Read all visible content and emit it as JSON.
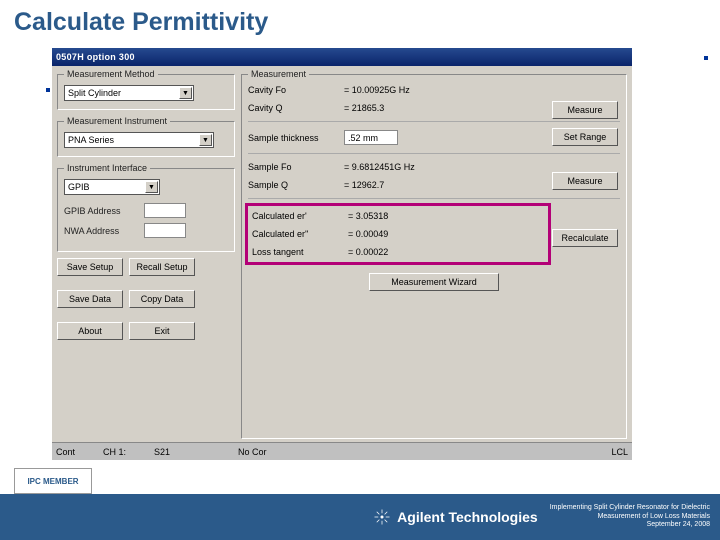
{
  "slide": {
    "title": "Calculate Permittivity"
  },
  "window": {
    "title": "0507H  option 300"
  },
  "method": {
    "legend": "Measurement Method",
    "value": "Split Cylinder"
  },
  "instrument": {
    "legend": "Measurement Instrument",
    "value": "PNA Series"
  },
  "iface": {
    "legend": "Instrument Interface",
    "value": "GPIB",
    "gpib_label": "GPIB Address",
    "nwa_label": "NWA Address"
  },
  "buttons": {
    "save_setup": "Save Setup",
    "recall_setup": "Recall Setup",
    "save_data": "Save Data",
    "copy_data": "Copy Data",
    "about": "About",
    "exit": "Exit",
    "measure": "Measure",
    "set_range": "Set Range",
    "recalc": "Recalculate",
    "wizard": "Measurement Wizard"
  },
  "meas": {
    "legend": "Measurement",
    "cavity_fo_label": "Cavity Fo",
    "cavity_fo_value": "= 10.00925G Hz",
    "cavity_q_label": "Cavity Q",
    "cavity_q_value": "= 21865.3",
    "sample_thickness_label": "Sample thickness",
    "sample_thickness_value": ".52 mm",
    "sample_fo_label": "Sample Fo",
    "sample_fo_value": "= 9.6812451G Hz",
    "sample_q_label": "Sample Q",
    "sample_q_value": "= 12962.7",
    "calc_er_prime_label": "Calculated er'",
    "calc_er_prime_value": "= 3.05318",
    "calc_er_dprime_label": "Calculated er''",
    "calc_er_dprime_value": "= 0.00049",
    "loss_tan_label": "Loss tangent",
    "loss_tan_value": "= 0.00022"
  },
  "status": {
    "cont": "Cont",
    "ch": "CH 1:",
    "s21": "S21",
    "nocor": "No Cor",
    "lcl": "LCL"
  },
  "footer": {
    "brand": "Agilent Technologies",
    "ipc": "IPC MEMBER",
    "line1": "Implementing Split Cylinder Resonator for Dielectric",
    "line2": "Measurement of Low Loss Materials",
    "line3": "September 24, 2008"
  }
}
